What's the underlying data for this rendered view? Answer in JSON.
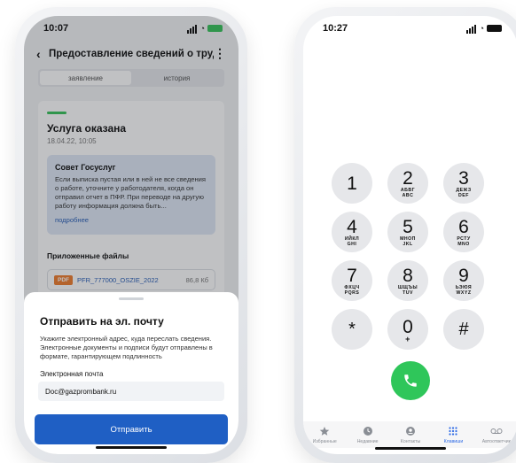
{
  "left_phone": {
    "status": {
      "time": "10:07"
    },
    "nav": {
      "back": "‹",
      "title": "Предоставление сведений о трудов...",
      "more": "⋮"
    },
    "segment": {
      "tab1": "заявление",
      "tab2": "история"
    },
    "service": {
      "title": "Услуга оказана",
      "date": "18.04.22, 10:05"
    },
    "advice": {
      "title": "Совет Госуслуг",
      "text": "Если выписка пустая или в ней не все сведения о работе, уточните у работодателя, когда он отправил отчет в ПФР. При переводе на другую работу информация должна быть...",
      "link": "подробнее"
    },
    "files": {
      "title": "Приложенные файлы",
      "items": [
        {
          "badge": "PDF",
          "name": "PFR_777000_OSZIE_2022",
          "size": "86,8 Кб"
        }
      ]
    },
    "sheet": {
      "title": "Отправить на эл. почту",
      "text": "Укажите электронный адрес, куда переслать сведения. Электронные документы и подписи будут отправлены в формате, гарантирующем подлинность",
      "email_label": "Электронная почта",
      "email_value": "Doc@gazprombank.ru",
      "send_label": "Отправить"
    },
    "colors": {
      "accent": "#1f5fc4",
      "green": "#38c25a",
      "pdf": "#ef7d2f"
    }
  },
  "right_phone": {
    "status": {
      "time": "10:27"
    },
    "keys": [
      {
        "digit": "1",
        "letters": ""
      },
      {
        "digit": "2",
        "letters": "АБВГ\nABC"
      },
      {
        "digit": "3",
        "letters": "ДЕЖЗ\nDEF"
      },
      {
        "digit": "4",
        "letters": "ИЙКЛ\nGHI"
      },
      {
        "digit": "5",
        "letters": "МНОП\nJKL"
      },
      {
        "digit": "6",
        "letters": "РСТУ\nMNO"
      },
      {
        "digit": "7",
        "letters": "ФХЦЧ\nPQRS"
      },
      {
        "digit": "8",
        "letters": "ШЩЪЫ\nTUV"
      },
      {
        "digit": "9",
        "letters": "ЬЭЮЯ\nWXYZ"
      },
      {
        "digit": "*",
        "letters": ""
      },
      {
        "digit": "0",
        "letters": "+"
      },
      {
        "digit": "#",
        "letters": ""
      }
    ],
    "call_icon": "phone-icon",
    "tabs": [
      {
        "label": "Избранные",
        "icon": "star-icon"
      },
      {
        "label": "Недавние",
        "icon": "clock-icon"
      },
      {
        "label": "Контакты",
        "icon": "contact-icon"
      },
      {
        "label": "Клавиши",
        "icon": "keypad-icon",
        "active": true
      },
      {
        "label": "Автоответчик",
        "icon": "voicemail-icon"
      }
    ],
    "colors": {
      "call": "#2fc65a",
      "active_tab": "#2f6be6"
    }
  }
}
